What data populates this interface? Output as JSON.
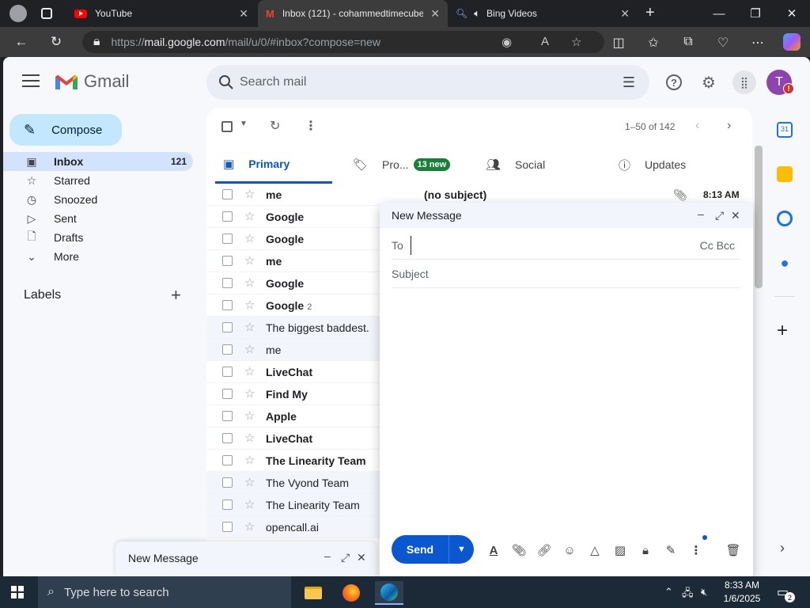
{
  "browser": {
    "tabs": [
      {
        "title": "YouTube",
        "icon": "youtube-icon"
      },
      {
        "title": "Inbox (121) - cohammedtimecube",
        "icon": "gmail-icon"
      },
      {
        "title": "Bing Videos",
        "icon": "bing-icon"
      }
    ],
    "url_prefix": "https://",
    "url_host": "mail.google.com",
    "url_path": "/mail/u/0/#inbox?compose=new"
  },
  "gmail": {
    "logo_text": "Gmail",
    "search_placeholder": "Search mail",
    "avatar_initial": "T",
    "avatar_badge": "!",
    "compose_label": "Compose",
    "nav": [
      {
        "label": "Inbox",
        "count": "121",
        "icon": "inbox-icon"
      },
      {
        "label": "Starred",
        "count": "",
        "icon": "star-icon"
      },
      {
        "label": "Snoozed",
        "count": "",
        "icon": "clock-icon"
      },
      {
        "label": "Sent",
        "count": "",
        "icon": "send-icon"
      },
      {
        "label": "Drafts",
        "count": "",
        "icon": "draft-icon"
      },
      {
        "label": "More",
        "count": "",
        "icon": "chevron-down-icon"
      }
    ],
    "labels_header": "Labels",
    "pager_text": "1–50 of 142",
    "tabs": [
      {
        "label": "Primary"
      },
      {
        "label": "Pro...",
        "badge": "13 new"
      },
      {
        "label": "Social"
      },
      {
        "label": "Updates"
      }
    ],
    "rows": [
      {
        "sender": "me",
        "count": "",
        "unread": true,
        "subject": "(no subject)",
        "time": "8:13 AM",
        "attachment": true
      },
      {
        "sender": "Google",
        "count": "",
        "unread": true
      },
      {
        "sender": "Google",
        "count": "",
        "unread": true
      },
      {
        "sender": "me",
        "count": "",
        "unread": true
      },
      {
        "sender": "Google",
        "count": "",
        "unread": true
      },
      {
        "sender": "Google",
        "count": "2",
        "unread": true
      },
      {
        "sender": "The biggest baddest.",
        "count": "",
        "unread": false
      },
      {
        "sender": "me",
        "count": "",
        "unread": false
      },
      {
        "sender": "LiveChat",
        "count": "",
        "unread": true
      },
      {
        "sender": "Find My",
        "count": "",
        "unread": true
      },
      {
        "sender": "Apple",
        "count": "",
        "unread": true
      },
      {
        "sender": "LiveChat",
        "count": "",
        "unread": true
      },
      {
        "sender": "The Linearity Team",
        "count": "",
        "unread": true
      },
      {
        "sender": "The Vyond Team",
        "count": "",
        "unread": false
      },
      {
        "sender": "The Linearity Team",
        "count": "",
        "unread": false
      },
      {
        "sender": "opencall.ai",
        "count": "",
        "unread": false
      }
    ],
    "compose": {
      "title": "New Message",
      "to_label": "To",
      "cc_bcc": "Cc Bcc",
      "subject_placeholder": "Subject",
      "send_label": "Send"
    },
    "mini_compose_title": "New Message"
  },
  "taskbar": {
    "search_placeholder": "Type here to search",
    "time": "8:33 AM",
    "date": "1/6/2025",
    "notification_count": "2"
  },
  "colors": {
    "accent": "#0b57d0",
    "compose_button": "#c2e7ff",
    "nav_active": "#d3e3fd",
    "new_badge": "#188038",
    "avatar": "#8e44ad"
  }
}
